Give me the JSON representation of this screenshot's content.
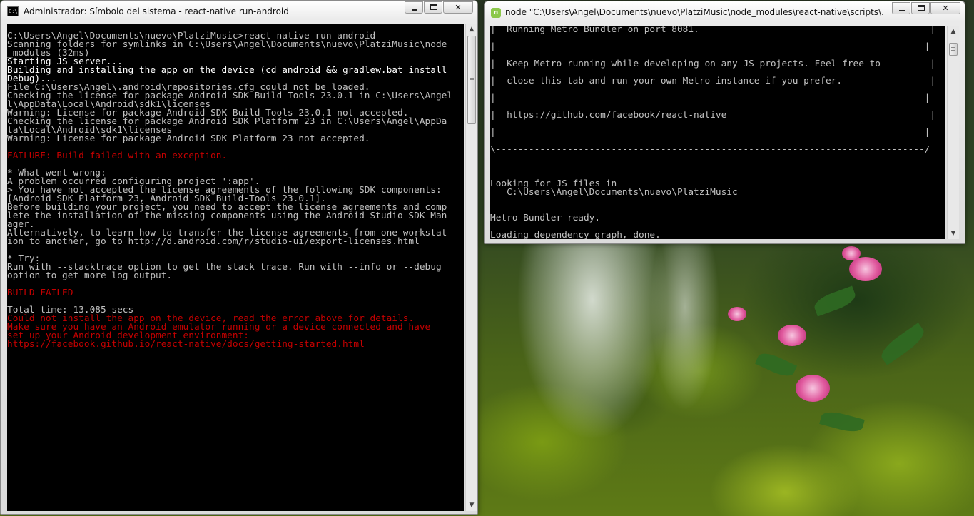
{
  "window_left": {
    "title": "Administrador: Símbolo del sistema - react-native  run-android",
    "icon": "cmd-icon",
    "buttons": {
      "minimize": "minimize",
      "maximize": "maximize",
      "close": "close"
    },
    "lines": [
      {
        "text": "",
        "style": "normal"
      },
      {
        "text": "C:\\Users\\Angel\\Documents\\nuevo\\PlatziMusic>react-native run-android",
        "style": "normal"
      },
      {
        "text": "Scanning folders for symlinks in C:\\Users\\Angel\\Documents\\nuevo\\PlatziMusic\\node",
        "style": "normal"
      },
      {
        "text": "_modules (32ms)",
        "style": "normal"
      },
      {
        "text": "Starting JS server...",
        "style": "bold"
      },
      {
        "text": "Building and installing the app on the device (cd android && gradlew.bat install",
        "style": "bold"
      },
      {
        "text": "Debug)...",
        "style": "bold"
      },
      {
        "text": "File C:\\Users\\Angel\\.android\\repositories.cfg could not be loaded.",
        "style": "normal"
      },
      {
        "text": "Checking the license for package Android SDK Build-Tools 23.0.1 in C:\\Users\\Angel",
        "style": "normal"
      },
      {
        "text": "l\\AppData\\Local\\Android\\sdk1\\licenses",
        "style": "normal"
      },
      {
        "text": "Warning: License for package Android SDK Build-Tools 23.0.1 not accepted.",
        "style": "normal"
      },
      {
        "text": "Checking the license for package Android SDK Platform 23 in C:\\Users\\Angel\\AppDa",
        "style": "normal"
      },
      {
        "text": "ta\\Local\\Android\\sdk1\\licenses",
        "style": "normal"
      },
      {
        "text": "Warning: License for package Android SDK Platform 23 not accepted.",
        "style": "normal"
      },
      {
        "text": "",
        "style": "normal"
      },
      {
        "text": "FAILURE: Build failed with an exception.",
        "style": "red"
      },
      {
        "text": "",
        "style": "normal"
      },
      {
        "text": "* What went wrong:",
        "style": "normal"
      },
      {
        "text": "A problem occurred configuring project ':app'.",
        "style": "normal"
      },
      {
        "text": "> You have not accepted the license agreements of the following SDK components:",
        "style": "normal"
      },
      {
        "text": "[Android SDK Platform 23, Android SDK Build-Tools 23.0.1].",
        "style": "normal"
      },
      {
        "text": "Before building your project, you need to accept the license agreements and comp",
        "style": "normal"
      },
      {
        "text": "lete the installation of the missing components using the Android Studio SDK Man",
        "style": "normal"
      },
      {
        "text": "ager.",
        "style": "normal"
      },
      {
        "text": "Alternatively, to learn how to transfer the license agreements from one workstat",
        "style": "normal"
      },
      {
        "text": "ion to another, go to http://d.android.com/r/studio-ui/export-licenses.html",
        "style": "normal"
      },
      {
        "text": "",
        "style": "normal"
      },
      {
        "text": "* Try:",
        "style": "normal"
      },
      {
        "text": "Run with --stacktrace option to get the stack trace. Run with --info or --debug",
        "style": "normal"
      },
      {
        "text": "option to get more log output.",
        "style": "normal"
      },
      {
        "text": "",
        "style": "normal"
      },
      {
        "text": "BUILD FAILED",
        "style": "red"
      },
      {
        "text": "",
        "style": "normal"
      },
      {
        "text": "Total time: 13.085 secs",
        "style": "normal"
      },
      {
        "text": "Could not install the app on the device, read the error above for details.",
        "style": "red"
      },
      {
        "text": "Make sure you have an Android emulator running or a device connected and have",
        "style": "red"
      },
      {
        "text": "set up your Android development environment:",
        "style": "red"
      },
      {
        "text": "https://facebook.github.io/react-native/docs/getting-started.html",
        "style": "red"
      }
    ]
  },
  "window_right": {
    "title": "node  \"C:\\Users\\Angel\\Documents\\nuevo\\PlatziMusic\\node_modules\\react-native\\scripts\\..\\local-c...",
    "icon": "node-icon",
    "buttons": {
      "minimize": "minimize",
      "maximize": "maximize",
      "close": "close"
    },
    "lines": [
      {
        "text": "|  Running Metro Bundler on port 8081.                                          |",
        "style": "normal"
      },
      {
        "text": "",
        "style": "normal"
      },
      {
        "text": "|                                                                              |",
        "style": "normal"
      },
      {
        "text": "",
        "style": "normal"
      },
      {
        "text": "|  Keep Metro running while developing on any JS projects. Feel free to         |",
        "style": "normal"
      },
      {
        "text": "",
        "style": "normal"
      },
      {
        "text": "|  close this tab and run your own Metro instance if you prefer.                |",
        "style": "normal"
      },
      {
        "text": "",
        "style": "normal"
      },
      {
        "text": "|                                                                              |",
        "style": "normal"
      },
      {
        "text": "",
        "style": "normal"
      },
      {
        "text": "|  https://github.com/facebook/react-native                                     |",
        "style": "normal"
      },
      {
        "text": "",
        "style": "normal"
      },
      {
        "text": "|                                                                              |",
        "style": "normal"
      },
      {
        "text": "",
        "style": "normal"
      },
      {
        "text": "\\------------------------------------------------------------------------------/",
        "style": "normal"
      },
      {
        "text": "",
        "style": "normal"
      },
      {
        "text": "",
        "style": "normal"
      },
      {
        "text": "",
        "style": "normal"
      },
      {
        "text": "Looking for JS files in",
        "style": "normal"
      },
      {
        "text": "   C:\\Users\\Angel\\Documents\\nuevo\\PlatziMusic",
        "style": "normal"
      },
      {
        "text": "",
        "style": "normal"
      },
      {
        "text": "",
        "style": "normal"
      },
      {
        "text": "Metro Bundler ready.",
        "style": "normal"
      },
      {
        "text": "",
        "style": "normal"
      },
      {
        "text": "Loading dependency graph, done.",
        "style": "normal"
      }
    ]
  },
  "colors": {
    "console_bg": "#000000",
    "console_text": "#c0c0c0",
    "console_bold": "#ffffff",
    "console_error": "#c40000"
  }
}
